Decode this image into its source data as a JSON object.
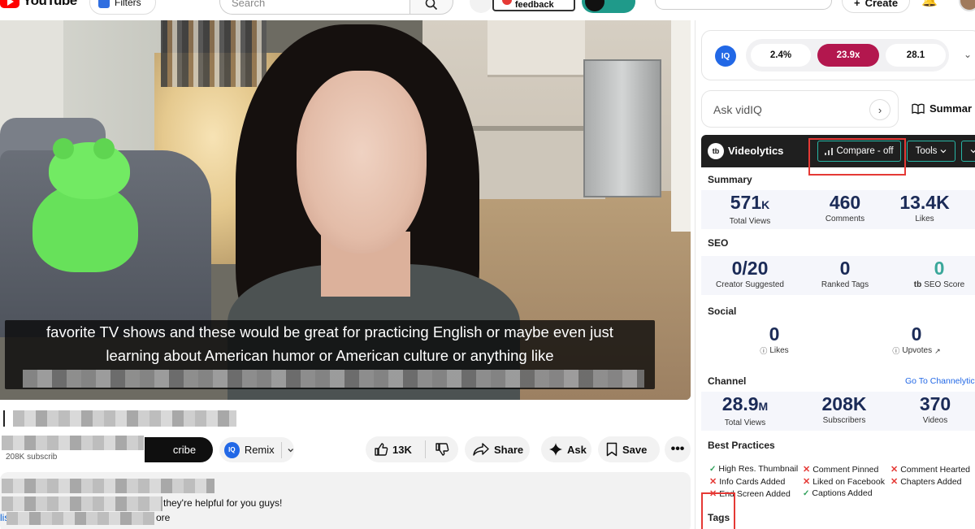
{
  "topbar": {
    "logo_text": "YouTube",
    "filters_label": "Filters",
    "search_placeholder": "Search",
    "live_feedback_label": "Live feedback",
    "create_label": "Create"
  },
  "video": {
    "caption_line1": "favorite TV shows and these would be great for practicing English or maybe even just",
    "caption_line2": "learning about American humor or American culture or anything like"
  },
  "below_video": {
    "subscribers_text": "208K subscrib",
    "subscribe_label": "cribe",
    "remix_label": "Remix",
    "remix_logo": "IQ",
    "like_count": "13K",
    "share_label": "Share",
    "ask_label": "Ask",
    "save_label": "Save",
    "more_label": "•••",
    "description_text": "they're helpful for you guys!",
    "description_link": "lis",
    "description_more": "ore"
  },
  "vidiq": {
    "logo": "IQ",
    "pill1": "2.4%",
    "pill2": "23.9x",
    "pill3": "28.1",
    "ask_placeholder": "Ask vidIQ",
    "summary_label": "Summar"
  },
  "videolytics": {
    "logo": "tb",
    "title": "Videolytics",
    "compare_label": "Compare - off",
    "tools_label": "Tools",
    "sections": {
      "summary": "Summary",
      "seo": "SEO",
      "social": "Social",
      "channel": "Channel",
      "best_practices": "Best Practices",
      "tags": "Tags"
    },
    "summary": {
      "views_value": "571",
      "views_suffix": "K",
      "views_label": "Total Views",
      "comments_value": "460",
      "comments_label": "Comments",
      "likes_value": "13.4K",
      "likes_label": "Likes"
    },
    "seo": {
      "suggested_value": "0/20",
      "suggested_label": "Creator Suggested",
      "ranked_value": "0",
      "ranked_label": "Ranked Tags",
      "score_value": "0",
      "score_label": "SEO Score"
    },
    "social": {
      "likes_value": "0",
      "likes_label": "Likes",
      "upvotes_value": "0",
      "upvotes_label": "Upvotes"
    },
    "channel": {
      "link_label": "Go To Channelytic",
      "views_value": "28.9",
      "views_suffix": "M",
      "views_label": "Total Views",
      "subs_value": "208K",
      "subs_label": "Subscribers",
      "videos_value": "370",
      "videos_label": "Videos"
    },
    "best_practices": [
      {
        "label": "High Res. Thumbnail",
        "ok": true
      },
      {
        "label": "Comment Pinned",
        "ok": false
      },
      {
        "label": "Comment Hearted",
        "ok": false
      },
      {
        "label": "Info Cards Added",
        "ok": false
      },
      {
        "label": "Liked on Facebook",
        "ok": false
      },
      {
        "label": "Chapters Added",
        "ok": false
      },
      {
        "label": "End Screen Added",
        "ok": false
      },
      {
        "label": "Captions Added",
        "ok": true
      }
    ]
  }
}
